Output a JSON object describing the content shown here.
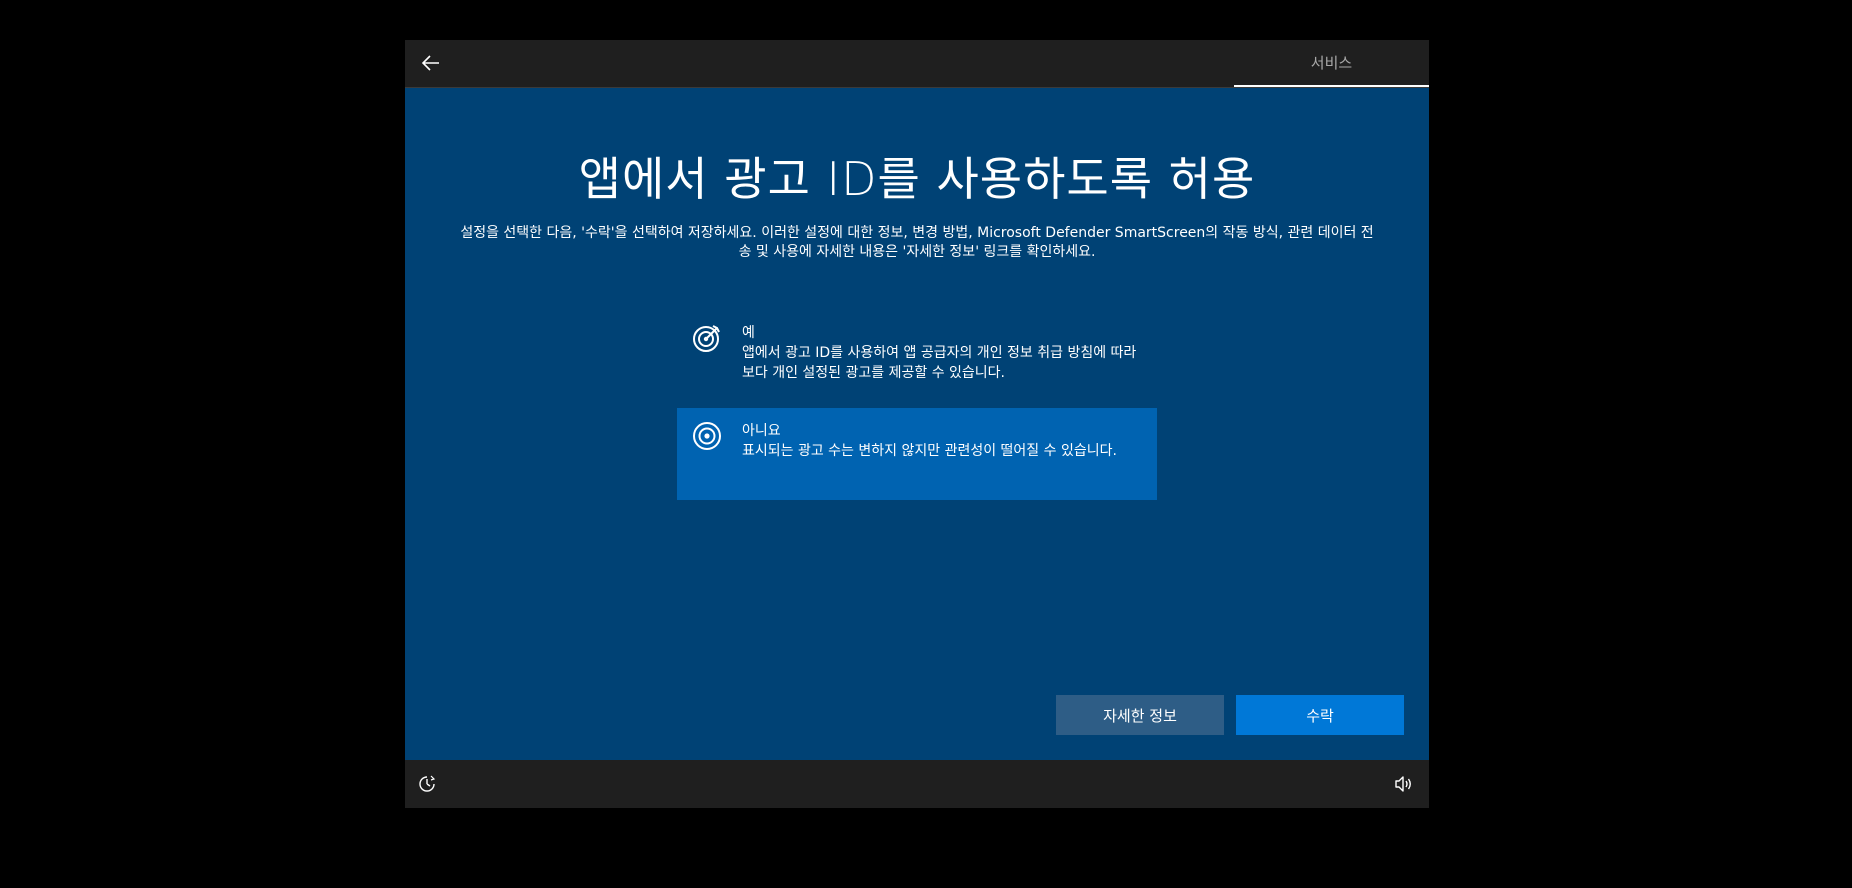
{
  "topbar": {
    "back_icon": "back-arrow-icon",
    "tab_label": "서비스"
  },
  "main": {
    "title": "앱에서 광고 ID를 사용하도록 허용",
    "subtitle": "설정을 선택한 다음, '수락'을 선택하여 저장하세요. 이러한 설정에 대한 정보, 변경 방법, Microsoft Defender SmartScreen의 작동 방식, 관련 데이터 전송 및 사용에 자세한 내용은 '자세한 정보' 링크를 확인하세요."
  },
  "options": [
    {
      "title": "예",
      "description": "앱에서 광고 ID를 사용하여 앱 공급자의 개인 정보 취급 방침에 따라 보다 개인 설정된 광고를 제공할 수 있습니다.",
      "icon": "target-arrow-icon",
      "selected": false
    },
    {
      "title": "아니요",
      "description": "표시되는 광고 수는 변하지 않지만 관련성이 떨어질 수 있습니다.",
      "icon": "target-icon",
      "selected": true
    }
  ],
  "buttons": {
    "learn_more": "자세한 정보",
    "accept": "수락"
  },
  "bottombar": {
    "accessibility_icon": "accessibility-icon",
    "volume_icon": "volume-icon"
  },
  "colors": {
    "background": "#004275",
    "selected_option": "#0063b1",
    "accept_button": "#0078d7",
    "learn_more_button": "#2e5d86",
    "bar": "#1f1f1f"
  }
}
